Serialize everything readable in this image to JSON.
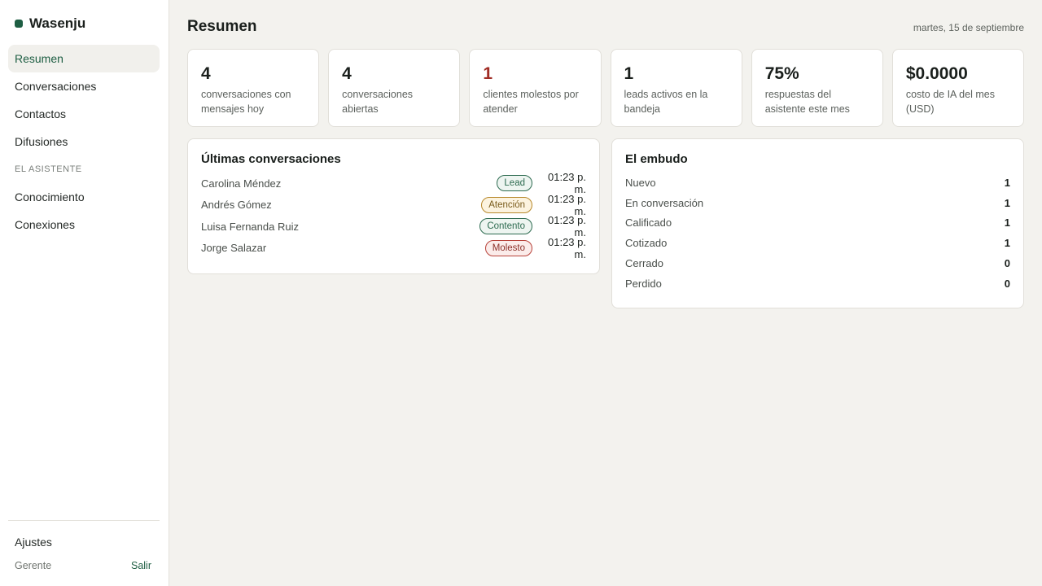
{
  "app": {
    "name": "Wasenju",
    "brand_color": "#1e5e43"
  },
  "sidebar": {
    "items": [
      {
        "label": "Resumen",
        "active": true
      },
      {
        "label": "Conversaciones"
      },
      {
        "label": "Contactos"
      },
      {
        "label": "Difusiones"
      }
    ],
    "section_label": "EL ASISTENTE",
    "assistant_items": [
      {
        "label": "Conocimiento"
      },
      {
        "label": "Conexiones"
      }
    ],
    "settings_label": "Ajustes",
    "user_role": "Gerente",
    "logout_label": "Salir"
  },
  "header": {
    "title": "Resumen",
    "date": "martes, 15 de septiembre"
  },
  "stats": [
    {
      "value": "4",
      "label": "conversaciones con mensajes hoy"
    },
    {
      "value": "4",
      "label": "conversaciones abiertas"
    },
    {
      "value": "1",
      "label": "clientes molestos por atender",
      "alert_color": "#a02c24"
    },
    {
      "value": "1",
      "label": "leads activos en la bandeja"
    },
    {
      "value": "75%",
      "label": "respuestas del asistente este mes"
    },
    {
      "value": "$0.0000",
      "label": "costo de IA del mes (USD)"
    }
  ],
  "conversations": {
    "title": "Últimas conversaciones",
    "rows": [
      {
        "name": "Carolina Méndez",
        "tag": "Lead",
        "time": "01:23 p. m."
      },
      {
        "name": "Andrés Gómez",
        "tag": "Atención",
        "time": "01:23 p. m."
      },
      {
        "name": "Luisa Fernanda Ruiz",
        "tag": "Contento",
        "time": "01:23 p. m."
      },
      {
        "name": "Jorge Salazar",
        "tag": "Molesto",
        "time": "01:23 p. m."
      }
    ]
  },
  "funnel": {
    "title": "El embudo",
    "rows": [
      {
        "label": "Nuevo",
        "count": "1"
      },
      {
        "label": "En conversación",
        "count": "1"
      },
      {
        "label": "Calificado",
        "count": "1"
      },
      {
        "label": "Cotizado",
        "count": "1"
      },
      {
        "label": "Cerrado",
        "count": "0"
      },
      {
        "label": "Perdido",
        "count": "0"
      }
    ]
  }
}
